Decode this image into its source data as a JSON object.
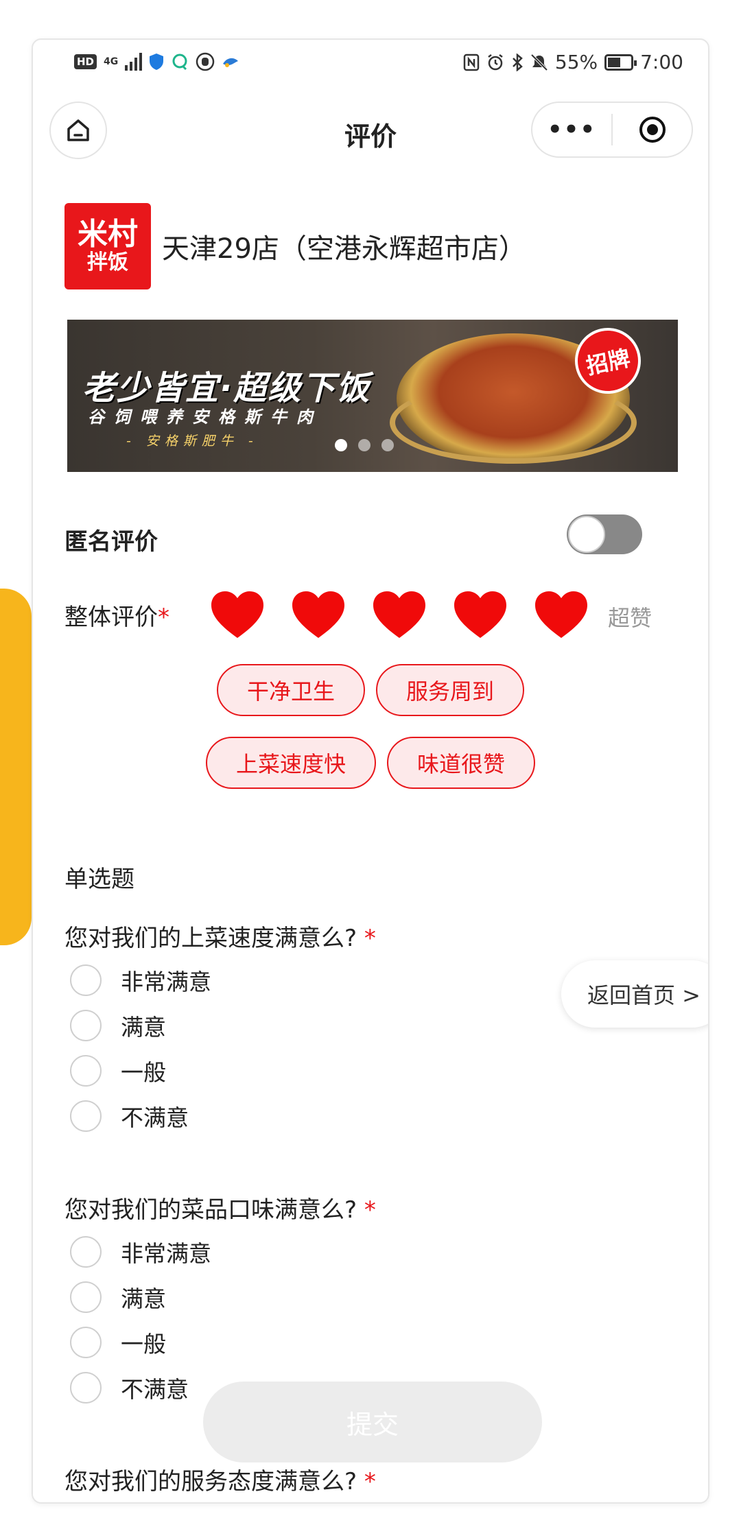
{
  "status_bar": {
    "left_badges": [
      "HD",
      "4G"
    ],
    "battery": "55%",
    "battery_level": 0.55,
    "time": "7:00"
  },
  "nav": {
    "title": "评价",
    "more_label": "•••",
    "icons": [
      "home-icon",
      "more-icon",
      "target-icon"
    ]
  },
  "store": {
    "logo_line1": "米村",
    "logo_line2": "拌饭",
    "name": "天津29店（空港永辉超市店）"
  },
  "banner": {
    "headline": "老少皆宜·超级下饭",
    "subline": "谷饲喂养安格斯牛肉",
    "tagline": "- 安格斯肥牛 -",
    "badge": "招牌",
    "slide_count": 3,
    "active_slide": 1
  },
  "anonymous": {
    "label": "匿名评价",
    "enabled": false
  },
  "overall_rating": {
    "label": "整体评价",
    "required_mark": "*",
    "value": 5,
    "max": 5,
    "rating_text": "超赞",
    "accent_color": "#e8171b"
  },
  "tags": {
    "row1": [
      "干净卫生",
      "服务周到"
    ],
    "row2": [
      "上菜速度快",
      "味道很赞"
    ]
  },
  "section_title": "单选题",
  "questions": [
    {
      "title": "您对我们的上菜速度满意么?",
      "required_mark": "*",
      "options": [
        "非常满意",
        "满意",
        "一般",
        "不满意"
      ]
    },
    {
      "title": "您对我们的菜品口味满意么?",
      "required_mark": "*",
      "options": [
        "非常满意",
        "满意",
        "一般",
        "不满意"
      ]
    },
    {
      "title": "您对我们的服务态度满意么?",
      "required_mark": "*",
      "options": []
    }
  ],
  "back_home_label": "返回首页 >",
  "submit_label": "提交"
}
